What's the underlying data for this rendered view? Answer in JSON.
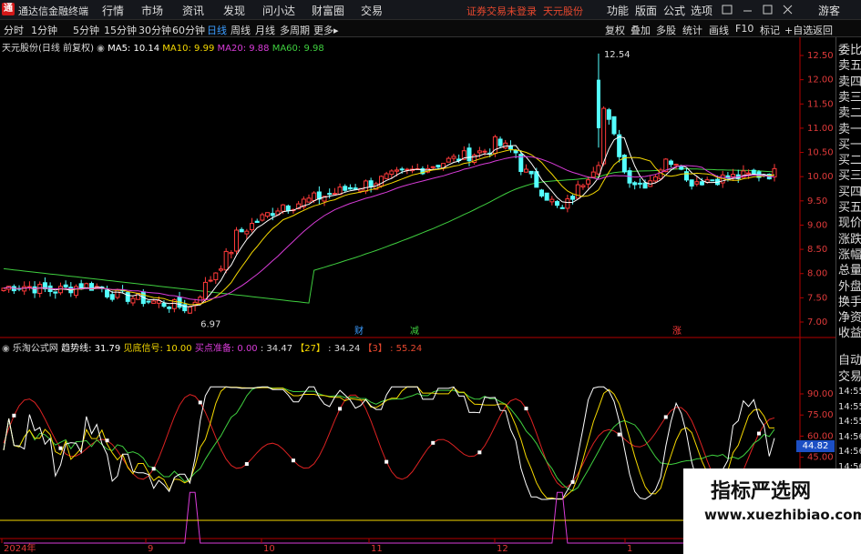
{
  "app": {
    "logo_char": "通",
    "title": "通达信金融终端"
  },
  "menu": [
    "行情",
    "市场",
    "资讯",
    "发现",
    "问小达",
    "财富圈",
    "交易"
  ],
  "notice": {
    "login": "证券交易未登录",
    "stock": "天元股份"
  },
  "window_menu": [
    "功能",
    "版面",
    "公式",
    "选项",
    "",
    "",
    "",
    "游客"
  ],
  "toolbar": {
    "periods": [
      "分时",
      "1分钟",
      "5分钟",
      "15分钟",
      "30分钟",
      "60分钟",
      "日线",
      "周线",
      "月线",
      "多周期",
      "更多▸"
    ],
    "active_period": "日线",
    "right": [
      "复权",
      "叠加",
      "多股",
      "统计",
      "画线",
      "F10",
      "标记",
      "+自选",
      "返回"
    ]
  },
  "main_chart": {
    "stock_name": "天元股份(日线 前复权)",
    "ma5": "MA5: 10.14",
    "ma10": "MA10: 9.99",
    "ma20": "MA20: 9.88",
    "ma60": "MA60: 9.98",
    "high_label": "12.54",
    "low_label": "6.97",
    "y_ticks": [
      "12.50",
      "12.00",
      "11.50",
      "11.00",
      "10.50",
      "10.00",
      "9.50",
      "9.00",
      "8.50",
      "8.00",
      "7.50",
      "7.00"
    ],
    "markers": [
      "财",
      "减",
      "涨"
    ],
    "colors": {
      "up": "#ff3a3a",
      "down": "#54ffff",
      "ma5": "#ffffff",
      "ma10": "#f5d800",
      "ma20": "#d83cd8",
      "ma60": "#3fcf3f"
    }
  },
  "indicator": {
    "name": "乐淘公式网",
    "trend": "趋势线: 31.79",
    "bottom": "见底信号: 10.00",
    "buy": "买点准备: 0.00",
    "v1": ": 34.47",
    "v2_tag": "【27】",
    "v2": ": 34.24",
    "v3_tag": "【3】",
    "v3": ": 55.24",
    "y_ticks": [
      "90.00",
      "75.00",
      "60.00",
      "45.00",
      "30.00",
      "15.00"
    ],
    "current_value": "44.82"
  },
  "x_axis": [
    "2024年",
    "9",
    "10",
    "11",
    "12",
    "1"
  ],
  "right_panel": {
    "labels": [
      "委比",
      "卖五",
      "卖四",
      "卖三",
      "卖二",
      "卖一",
      "买一",
      "买二",
      "买三",
      "买四",
      "买五",
      "现价",
      "涨跌",
      "涨幅",
      "总量",
      "外盘",
      "换手",
      "净资",
      "收益"
    ],
    "auto": "自动",
    "trade": "交易",
    "times": [
      "14:55",
      "14:55",
      "14:55",
      "14:56",
      "14:56",
      "14:56",
      "14:56",
      "14:56",
      "14:56",
      "14:56"
    ]
  },
  "watermark": {
    "line1": "指标严选网",
    "line2": "www.xuezhibiao.com"
  }
}
